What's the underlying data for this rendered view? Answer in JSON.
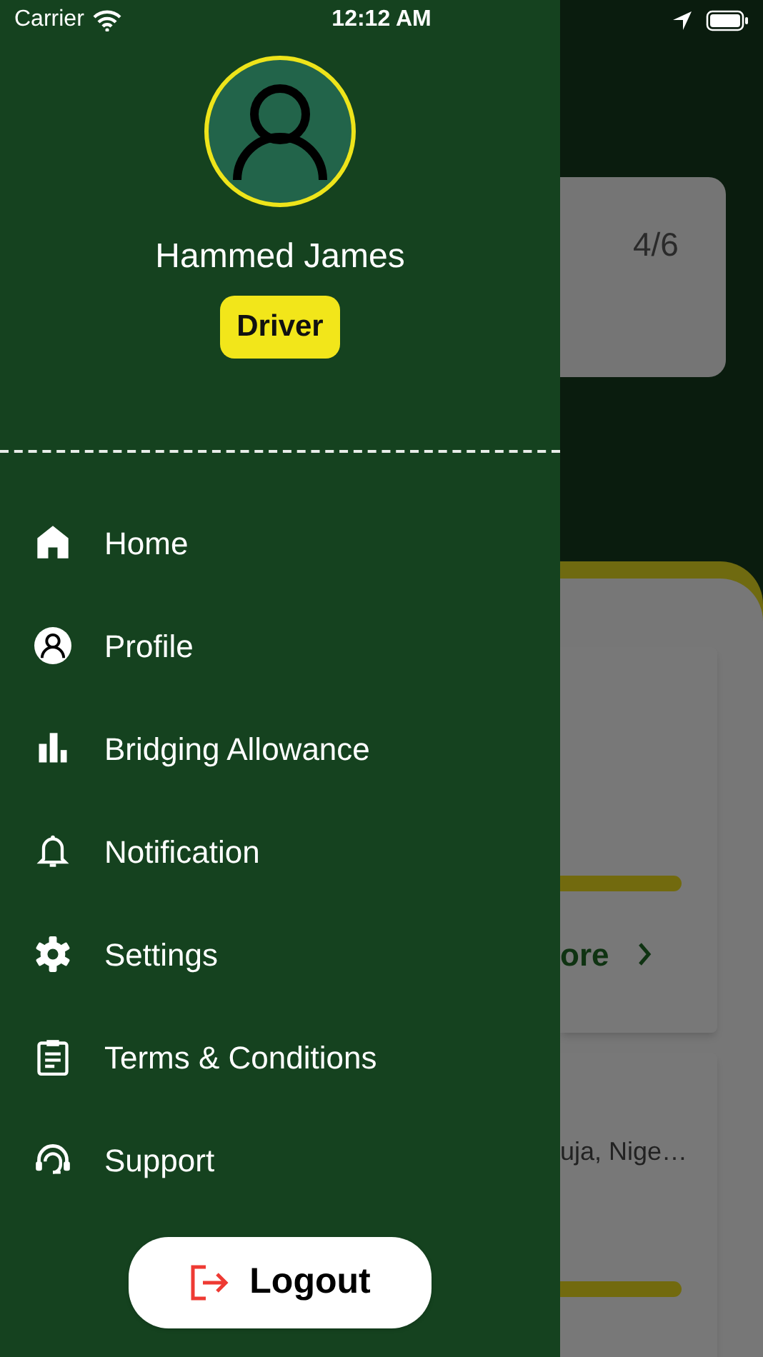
{
  "status_bar": {
    "carrier": "Carrier",
    "time": "12:12 AM"
  },
  "drawer": {
    "user_name": "Hammed James",
    "role_badge": "Driver",
    "menu": [
      {
        "kind": "home",
        "label": "Home"
      },
      {
        "kind": "profile",
        "label": "Profile"
      },
      {
        "kind": "chart",
        "label": "Bridging Allowance"
      },
      {
        "kind": "bell",
        "label": "Notification"
      },
      {
        "kind": "gear",
        "label": "Settings"
      },
      {
        "kind": "clipboard",
        "label": "Terms & Conditions"
      },
      {
        "kind": "support",
        "label": "Support"
      }
    ],
    "logout_button": "Logout"
  },
  "background": {
    "progress_count": "4/6",
    "cards": [
      {
        "link": "ore"
      },
      {
        "line": "uja, Nige…"
      }
    ]
  }
}
